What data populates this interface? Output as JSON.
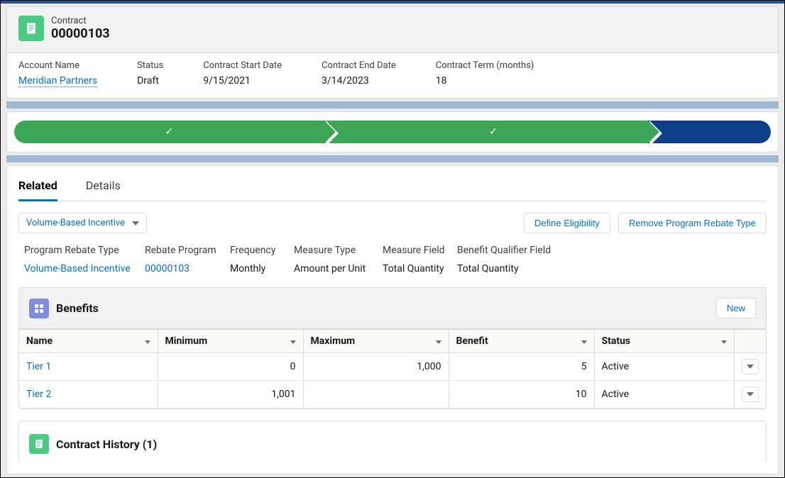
{
  "header": {
    "eyebrow": "Contract",
    "title": "00000103"
  },
  "fields": {
    "accountName": {
      "label": "Account Name",
      "value": "Meridian Partners"
    },
    "status": {
      "label": "Status",
      "value": "Draft"
    },
    "startDate": {
      "label": "Contract Start Date",
      "value": "9/15/2021"
    },
    "endDate": {
      "label": "Contract End Date",
      "value": "3/14/2023"
    },
    "term": {
      "label": "Contract Term (months)",
      "value": "18"
    }
  },
  "tabs": {
    "related": "Related",
    "details": "Details"
  },
  "picker": {
    "label": "Volume-Based Incentive"
  },
  "actions": {
    "defineEligibility": "Define Eligibility",
    "removeType": "Remove Program Rebate Type",
    "new": "New"
  },
  "meta": {
    "headers": {
      "programRebateType": "Program Rebate Type",
      "rebateProgram": "Rebate Program",
      "frequency": "Frequency",
      "measureType": "Measure Type",
      "measureField": "Measure Field",
      "benefitQualifierField": "Benefit Qualifier Field"
    },
    "values": {
      "programRebateType": "Volume-Based Incentive",
      "rebateProgram": "00000103",
      "frequency": "Monthly",
      "measureType": "Amount per Unit",
      "measureField": "Total Quantity",
      "benefitQualifierField": "Total Quantity"
    }
  },
  "benefits": {
    "title": "Benefits",
    "columns": {
      "name": "Name",
      "min": "Minimum",
      "max": "Maximum",
      "benefit": "Benefit",
      "status": "Status"
    },
    "rows": [
      {
        "name": "Tier 1",
        "min": "0",
        "max": "1,000",
        "benefit": "5",
        "status": "Active"
      },
      {
        "name": "Tier 2",
        "min": "1,001",
        "max": "",
        "benefit": "10",
        "status": "Active"
      }
    ]
  },
  "history": {
    "title": "Contract History (1)"
  }
}
